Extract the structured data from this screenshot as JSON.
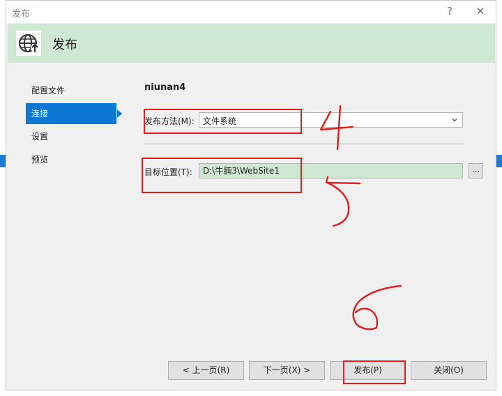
{
  "window": {
    "title": "发布",
    "help_glyph": "?",
    "close_glyph": "✕"
  },
  "header": {
    "title": "发布",
    "icon": "globe-publish-icon"
  },
  "nav": {
    "items": [
      {
        "label": "配置文件",
        "active": false
      },
      {
        "label": "连接",
        "active": true
      },
      {
        "label": "设置",
        "active": false
      },
      {
        "label": "预览",
        "active": false
      }
    ]
  },
  "connection": {
    "profile_name": "niunan4",
    "method_label": "发布方法(M):",
    "method_value": "文件系统",
    "target_label": "目标位置(T):",
    "target_value": "D:\\牛腩3\\WebSite1",
    "browse_label": "..."
  },
  "footer": {
    "prev_label": "< 上一页(R)",
    "next_label": "下一页(X) >",
    "publish_label": "发布(P)",
    "close_label": "关闭(O)"
  },
  "colors": {
    "accent": "#0a78d4",
    "header_bg": "#cfe8d3",
    "annotation": "#e41d1d"
  }
}
